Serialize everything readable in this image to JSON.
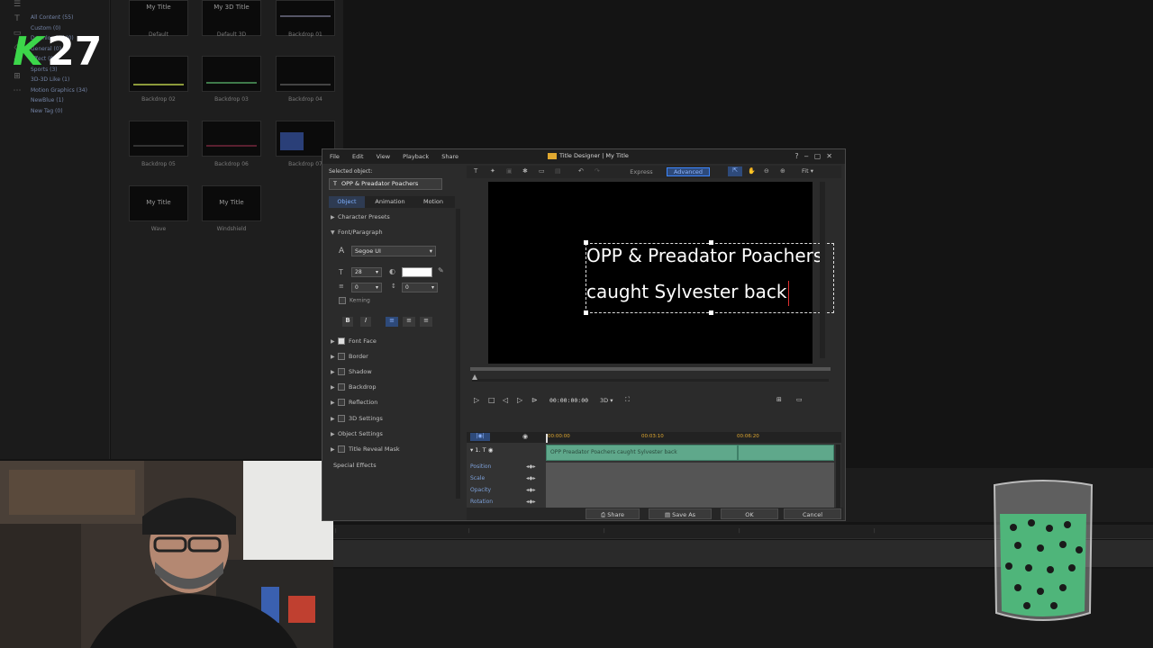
{
  "left_panel": {
    "tree": [
      "All Content (55)",
      "Custom (0)",
      "Downloaded (0)",
      "General (0)",
      "Effect (0)",
      "Sports (3)",
      "3D-3D Like (1)",
      "Motion Graphics (34)",
      "NewBlue (1)",
      "New Tag (0)"
    ]
  },
  "library": {
    "thumbs": [
      {
        "title": "My Title",
        "label": "Default"
      },
      {
        "title": "My 3D Title",
        "label": "Default 3D"
      },
      {
        "title": "",
        "label": "Backdrop 01"
      },
      {
        "title": "",
        "label": "Backdrop 02"
      },
      {
        "title": "",
        "label": "Backdrop 03"
      },
      {
        "title": "",
        "label": "Backdrop 04"
      },
      {
        "title": "",
        "label": "Backdrop 05"
      },
      {
        "title": "",
        "label": "Backdrop 06"
      },
      {
        "title": "",
        "label": "Backdrop 07"
      },
      {
        "title": "My Title",
        "label": "Wave"
      },
      {
        "title": "My Title",
        "label": "Windshield"
      }
    ]
  },
  "overlay": {
    "letter": "K",
    "number": "27"
  },
  "dialog": {
    "menu": [
      "File",
      "Edit",
      "View",
      "Playback",
      "Share"
    ],
    "title": "Title Designer | My Title",
    "selected_object_label": "Selected object:",
    "selected_object_value": "OPP & Preadator Poachers",
    "tabs": [
      "Object",
      "Animation",
      "Motion"
    ],
    "sections": {
      "character_presets": "Character Presets",
      "font_paragraph": "Font/Paragraph",
      "font_face": "Font Face",
      "border": "Border",
      "shadow": "Shadow",
      "backdrop": "Backdrop",
      "reflection": "Reflection",
      "settings_3d": "3D Settings",
      "object_settings": "Object Settings",
      "title_reveal_mask": "Title Reveal Mask",
      "special_effects": "Special Effects"
    },
    "font": {
      "name": "Segoe UI",
      "size": "28",
      "line_spacing": "0",
      "char_spacing": "0",
      "kerning": "Kerning"
    },
    "mode": {
      "express": "Express",
      "advanced": "Advanced",
      "fit": "Fit"
    },
    "preview_text": {
      "line1": "OPP & Preadator Poachers",
      "line2": "caught Sylvester back"
    },
    "timecode": "00:00:00:00",
    "mode3d": "3D",
    "timeline": {
      "ruler": [
        "00:00:00",
        "00:03:10",
        "00:06:20"
      ],
      "track_num": "1.",
      "clip_label": "OPP  Preadator Poachers caught Sylvester back",
      "rows": [
        "Position",
        "Scale",
        "Opacity",
        "Rotation"
      ]
    },
    "buttons": {
      "share": "Share",
      "save_as": "Save As",
      "ok": "OK",
      "cancel": "Cancel"
    }
  },
  "colors": {
    "accent": "#3b86ff",
    "clip": "#5fa88b",
    "overlay_green": "#3cd64a"
  }
}
